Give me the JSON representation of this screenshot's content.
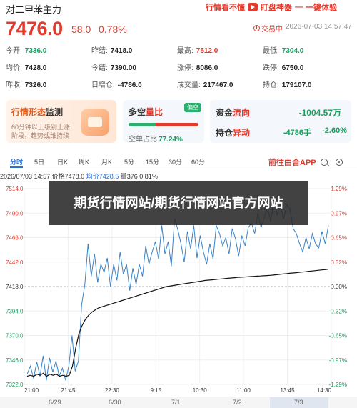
{
  "header": {
    "title": "对二甲苯主力",
    "promo": {
      "part1": "行情看不懂",
      "part2": "盯盘神器",
      "dash": "—",
      "part3": "一键体验"
    },
    "price": "7476.0",
    "change": "58.0",
    "change_pct": "0.78%",
    "status": "交易中",
    "timestamp": "2026-07-03 14:57:47"
  },
  "stats": [
    [
      {
        "label": "今开:",
        "value": "7336.0",
        "color": "green"
      },
      {
        "label": "昨结:",
        "value": "7418.0",
        "color": "dark"
      },
      {
        "label": "最高:",
        "value": "7512.0",
        "color": "red"
      },
      {
        "label": "最低:",
        "value": "7304.0",
        "color": "green"
      }
    ],
    [
      {
        "label": "均价:",
        "value": "7428.0",
        "color": "dark"
      },
      {
        "label": "今结:",
        "value": "7390.00",
        "color": "dark"
      },
      {
        "label": "涨停:",
        "value": "8086.0",
        "color": "dark"
      },
      {
        "label": "跌停:",
        "value": "6750.0",
        "color": "dark"
      }
    ],
    [
      {
        "label": "昨收:",
        "value": "7326.0",
        "color": "dark"
      },
      {
        "label": "日增仓:",
        "value": "-4786.0",
        "color": "dark"
      },
      {
        "label": "成交量:",
        "value": "217467.0",
        "color": "dark"
      },
      {
        "label": "持仓:",
        "value": "179107.0",
        "color": "dark"
      }
    ]
  ],
  "cards": {
    "trend": {
      "title_a": "行情形态",
      "title_b": "监测",
      "line1": "60分钟以上级别上涨",
      "line2": "阶段，趋势或维持续"
    },
    "longshort": {
      "title_a": "多空",
      "title_b": "量比",
      "tag": "偏空",
      "label": "空单占比",
      "value": "77.24%",
      "short_ratio": 0.7724
    },
    "capital": {
      "label_a": "资金",
      "label_b": "流向",
      "value": "-1004.57万"
    },
    "position": {
      "label_a": "持仓",
      "label_b": "异动",
      "value": "-4786手",
      "pct": "-2.60%"
    }
  },
  "tabs": {
    "items": [
      "分时",
      "5日",
      "日K",
      "周K",
      "月K",
      "5分",
      "15分",
      "30分",
      "60分"
    ],
    "active": 0,
    "app_link": "前往由合APP"
  },
  "infoline": {
    "date": "2026/07/03",
    "time": "14:57",
    "price_label": "价格",
    "price": "7478.0",
    "avg_label": "均价",
    "avg": "7428.5",
    "vol_label": "量",
    "vol": "376",
    "pct": "0.81%"
  },
  "overlay_text": "期货行情网站/期货行情网站官方网站",
  "chart_data": {
    "type": "line",
    "y_ticks": [
      "7514.0",
      "7490.0",
      "7466.0",
      "7442.0",
      "7418.0",
      "7394.0",
      "7370.0",
      "7346.0",
      "7322.0"
    ],
    "pct_ticks": [
      "1.29%",
      "0.97%",
      "0.65%",
      "0.32%",
      "0.00%",
      "-0.32%",
      "-0.65%",
      "-0.97%",
      "-1.29%"
    ],
    "x_ticks": [
      "21:00",
      "21:45",
      "22:30",
      "9:15",
      "10:30",
      "11:00",
      "13:45",
      "14:30"
    ],
    "ylim": [
      7322,
      7514
    ],
    "series": [
      {
        "color": "#3b82c4",
        "values": [
          7332,
          7340,
          7328,
          7344,
          7330,
          7350,
          7326,
          7348,
          7334,
          7345,
          7330,
          7338,
          7326,
          7340,
          7370,
          7335,
          7345,
          7400,
          7420,
          7460,
          7428,
          7450,
          7422,
          7440,
          7432,
          7446,
          7418,
          7440,
          7424,
          7452,
          7430,
          7440,
          7414,
          7436,
          7420,
          7440,
          7428,
          7458,
          7440,
          7452,
          7462,
          7445,
          7478,
          7450,
          7462,
          7438,
          7485,
          7474,
          7460,
          7442,
          7472,
          7455,
          7478,
          7446,
          7468,
          7452,
          7440,
          7460,
          7445,
          7478,
          7470,
          7458,
          7466,
          7450,
          7475,
          7465,
          7448,
          7468,
          7458,
          7476,
          7480,
          7470,
          7490,
          7476,
          7486,
          7495,
          7482,
          7505,
          7488,
          7500,
          7484,
          7498,
          7494,
          7475,
          7470,
          7460,
          7452,
          7466,
          7455,
          7470,
          7460,
          7456,
          7472,
          7460,
          7478
        ]
      },
      {
        "color": "#111111",
        "values": [
          7330,
          7331,
          7330,
          7332,
          7331,
          7333,
          7330,
          7332,
          7331,
          7332,
          7330,
          7331,
          7330,
          7331,
          7340,
          7358,
          7372,
          7380,
          7386,
          7390,
          7393,
          7395,
          7397,
          7398,
          7399,
          7400,
          7401,
          7402,
          7403,
          7404,
          7405,
          7406,
          7407,
          7408,
          7409,
          7410,
          7411,
          7412,
          7413,
          7414,
          7415,
          7416,
          7417,
          7418,
          7418.5,
          7419,
          7419.5,
          7420,
          7420.5,
          7421,
          7421.5,
          7422,
          7422.5,
          7423,
          7423.5,
          7424,
          7424.3,
          7424.6,
          7424.9,
          7425.2,
          7425.5,
          7425.8,
          7426.1,
          7426.4,
          7426.7,
          7427,
          7427.2,
          7427.4,
          7427.6,
          7427.8,
          7428,
          7428.2,
          7428.4,
          7428.6,
          7428.8,
          7429,
          7429.3,
          7429.6,
          7430,
          7430.3,
          7430.6,
          7431,
          7431.3,
          7431.6,
          7432,
          7432.3,
          7432.6,
          7433,
          7433.3,
          7433.6,
          7434,
          7434.3,
          7434.6,
          7435
        ]
      }
    ]
  },
  "minibar": {
    "dates": [
      "6/29",
      "6/30",
      "7/1",
      "7/2",
      "7/3"
    ]
  }
}
